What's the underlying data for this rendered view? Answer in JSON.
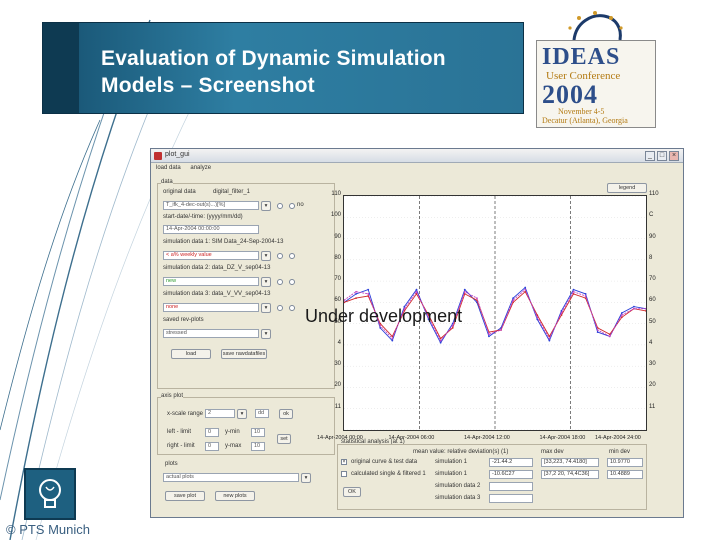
{
  "slide": {
    "title_line1": "Evaluation of Dynamic Simulation",
    "title_line2": "Models – Screenshot",
    "overlay": "Under development",
    "footer": "© PTS Munich"
  },
  "logo": {
    "brand": "IDEAS",
    "conference": "User Conference",
    "year": "2004",
    "dates": "November 4-5",
    "place": "Decatur (Atlanta), Georgia"
  },
  "app_window": {
    "title": "plot_gui",
    "menu": [
      "load data",
      "analyze"
    ],
    "window_buttons": [
      "_",
      "□",
      "×"
    ],
    "panel_data": {
      "group_label": "data",
      "original_data_label": "original data",
      "digital_filter_label": "digital_filter_1",
      "original_file": "T_ifk_4-dec-out(s)...)[%]",
      "original_file_status": "no",
      "file_date_label": "start-date/-time: (yyyy/mm/dd)",
      "file_date_value": "14-Apr-2004 00:00:00",
      "sim1_label": "simulation data 1: SIM Data_24-Sep-2004-13",
      "sim1_value": "< a% weekly value",
      "sim2_label": "simulation data 2: data_DZ_V_sep04-13",
      "sim2_value": "new",
      "sim3_label": "simulation data 3: data_V_VV_sep04-13",
      "sim3_value": "none",
      "saved_label": "saved rev-plots",
      "saved_value": "stressed",
      "load_button": "load",
      "save_button": "save rawdatafiles",
      "yes_label": "yes",
      "no_label": "no"
    },
    "panel_axes": {
      "group_label": "axis plot",
      "scale_label": "x-scale range",
      "scale_value": "2",
      "scale_unit": "dd",
      "ok_button": "ok",
      "left_limit_label": "left - limit",
      "left_limit_value": "0",
      "right_limit_label": "right - limit",
      "right_limit_value": "0",
      "y_min_label": "y-min",
      "y_min_value": "10",
      "y_max_label": "y-max",
      "y_max_value": "10",
      "set_button": "set",
      "plots_label": "plots",
      "plots_value": "actual plots",
      "save_plot_button": "save plot",
      "new_plot_button": "new plots"
    },
    "plot_controls": {
      "legend_button": "legend"
    },
    "stats_table": {
      "group_label": "statistical analysis (at 1)",
      "header_col1": "mean value: relative deviation(s) (1)",
      "header_col2": "max dev",
      "header_col3": "min dev",
      "rows": [
        {
          "check": "×",
          "label": "original curve & test data",
          "name": "simulation 1",
          "value": "-21.44.2",
          "range": "[33,223, 74.4180]",
          "extra": "10.9770"
        },
        {
          "check": "",
          "label": "calculated single & filtered 1",
          "name": "simulation 1",
          "value": "-10.6C27",
          "range": "[37,2 20, 74,4C36]",
          "extra": "10.4889"
        },
        {
          "check": "",
          "label": "",
          "name": "simulation data 2",
          "value": "",
          "range": "",
          "extra": ""
        },
        {
          "check": "",
          "label": "",
          "name": "simulation data 3",
          "value": "",
          "range": "",
          "extra": ""
        }
      ],
      "ok_button": "OK"
    }
  },
  "chart_data": {
    "type": "line",
    "title": "",
    "xlabel": "",
    "ylabel": "",
    "ylim": [
      0,
      110
    ],
    "yticks": [
      0,
      10,
      20,
      30,
      40,
      50,
      60,
      70,
      80,
      90,
      100,
      110
    ],
    "yticks_left_labels": [
      "",
      "11",
      "20",
      "30",
      "4",
      "50",
      "60",
      "70",
      "80",
      "90",
      "100",
      "110"
    ],
    "yticks_right_labels": [
      "",
      "11",
      "20",
      "30",
      "4",
      "50",
      "60",
      "70",
      "8",
      "90",
      "C",
      "110"
    ],
    "xtick_labels": [
      "14-Apr-2004 00:00",
      "14-Apr-2004 06:00",
      "14-Apr-2004 12:00",
      "14-Apr-2004 18:00",
      "14-Apr-2004 24:00"
    ],
    "vertical_markers": [
      0.25,
      0.5,
      0.75
    ],
    "x": [
      0,
      0.04,
      0.08,
      0.12,
      0.16,
      0.2,
      0.24,
      0.28,
      0.32,
      0.36,
      0.4,
      0.44,
      0.48,
      0.52,
      0.56,
      0.6,
      0.64,
      0.68,
      0.72,
      0.76,
      0.8,
      0.84,
      0.88,
      0.92,
      0.96,
      1.0
    ],
    "series": [
      {
        "color": "#2b3fd8",
        "values": [
          60,
          64,
          66,
          48,
          42,
          58,
          66,
          52,
          41,
          50,
          66,
          60,
          44,
          48,
          62,
          67,
          52,
          42,
          56,
          66,
          64,
          46,
          44,
          55,
          58,
          57
        ]
      },
      {
        "color": "#d02a2a",
        "values": [
          60,
          62,
          63,
          50,
          44,
          56,
          64,
          54,
          43,
          48,
          64,
          61,
          46,
          47,
          60,
          65,
          54,
          44,
          54,
          64,
          62,
          48,
          45,
          53,
          57,
          56
        ]
      },
      {
        "color": "#c040c0",
        "values": [
          61,
          65,
          64,
          49,
          43,
          57,
          65,
          53,
          42,
          49,
          65,
          62,
          45,
          47,
          61,
          66,
          53,
          43,
          55,
          65,
          63,
          47,
          44,
          54,
          57,
          57
        ]
      }
    ]
  }
}
